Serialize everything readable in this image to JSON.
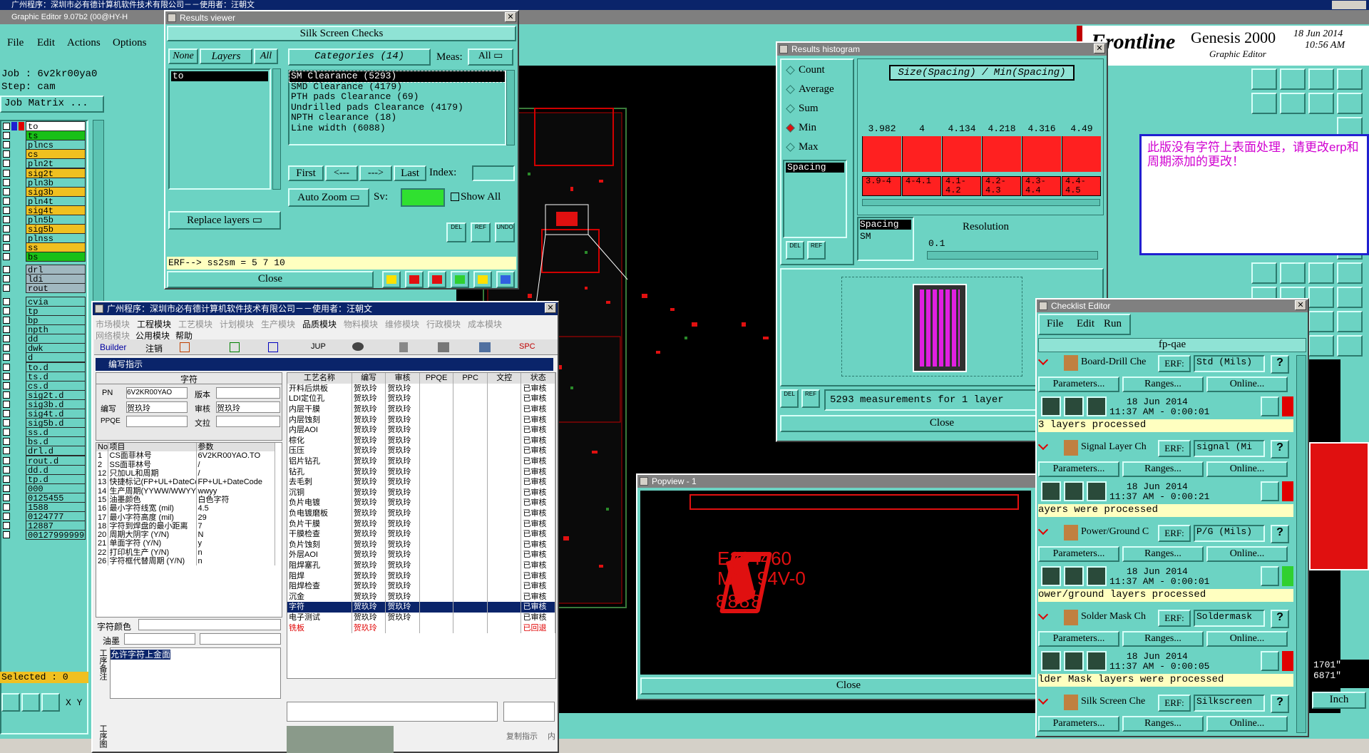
{
  "main_title": "广州程序：深圳市必有德计算机软件技术有限公司－－使用者：汪朝文",
  "ge_title": "Graphic Editor 9.07b2 (00@HY-H",
  "menu": [
    "File",
    "Edit",
    "Actions",
    "Options"
  ],
  "job": "Job : 6v2kr00ya0",
  "step": "Step: cam",
  "job_matrix": "Job Matrix ...",
  "layers": [
    "to",
    "ts",
    "plncs",
    "cs",
    "pln2t",
    "sig2t",
    "pln3b",
    "sig3b",
    "pln4t",
    "sig4t",
    "pln5b",
    "sig5b",
    "plnss",
    "ss",
    "bs",
    "drl",
    "ldi",
    "rout",
    "cvia",
    "tp",
    "bp",
    "npth",
    "dd",
    "dwk",
    "d",
    "to.d",
    "ts.d",
    "cs.d",
    "sig2t.d",
    "sig3b.d",
    "sig4t.d",
    "sig5b.d",
    "ss.d",
    "bs.d",
    "drl.d",
    "rout.d",
    "dd.d",
    "tp.d",
    "000",
    "0125455",
    "1588",
    "0124777",
    "12887",
    "00127999999"
  ],
  "selected": "Selected : 0",
  "xy": "X Y",
  "brand": {
    "name": "Frontline",
    "product": "Genesis 2000",
    "sub": "Graphic Editor",
    "date": "18 Jun 2014",
    "time": "10:56 AM"
  },
  "results": {
    "title": "Results viewer",
    "header": "Silk Screen Checks",
    "none": "None",
    "layers_label": "Layers",
    "all": "All",
    "layer_item": "to",
    "categories": "Categories (14)",
    "meas": "Meas:",
    "meas_val": "All",
    "items": [
      "SM Clearance (5293)",
      "SMD Clearance (4179)",
      "PTH pads Clearance (69)",
      "Undrilled pads Clearance (4179)",
      "NPTH clearance (18)",
      "Line width (6088)"
    ],
    "first": "First",
    "prev": "<---",
    "next": "--->",
    "last": "Last",
    "index": "Index:",
    "auto_zoom": "Auto Zoom",
    "sv": "Sv:",
    "show_all": "Show All",
    "replace": "Replace layers",
    "del": "DEL",
    "ref": "REF",
    "undo": "UNDO",
    "erf": "ERF--> ss2sm = 5 7 10",
    "close": "Close"
  },
  "histogram": {
    "title": "Results histogram",
    "options": [
      "Count",
      "Average",
      "Sum",
      "Min",
      "Max"
    ],
    "selected": "Min",
    "graph_title": "Size(Spacing) / Min(Spacing)",
    "values": [
      "3.982",
      "4",
      "4.134",
      "4.218",
      "4.316",
      "4.49"
    ],
    "bins": [
      "3.9-4",
      "4-4.1",
      "4.1-4.2",
      "4.2-4.3",
      "4.3-4.4",
      "4.4-4.5"
    ],
    "list_item": "Spacing",
    "spacing": "Spacing",
    "sm": "SM",
    "resolution": "Resolution",
    "res_val": "0.1",
    "measurements": "5293 measurements for 1 layer",
    "close": "Close",
    "del": "DEL",
    "ref": "REF",
    "bar_color": "#ff2020"
  },
  "note": "此版没有字符上表面处理，请更改erp和周期添加的更改！",
  "cn": {
    "title": "广州程序：深圳市必有德计算机软件技术有限公司－－使用者：汪朝文",
    "modules": [
      "市场模块",
      "工程模块",
      "工艺模块",
      "计划模块",
      "生产模块",
      "品质模块",
      "物料模块",
      "维修模块",
      "行政模块",
      "成本模块"
    ],
    "modules2": [
      "网络模块",
      "公用模块",
      "帮助"
    ],
    "toolbar": [
      "Builder",
      "注销",
      "JUP",
      "SPC"
    ],
    "section": "编写指示",
    "form_header": "字符",
    "pn_label": "PN",
    "pn": "6V2KR00YAO",
    "ver_label": "版本",
    "writer_label": "编写",
    "writer": "贺玖玲",
    "auditor_label": "审核",
    "auditor": "贺玖玲",
    "ppqe": "PPQE",
    "wl": "文拉",
    "grid_head": [
      "No",
      "项目",
      "参数"
    ],
    "grid": [
      [
        "1",
        "CS面菲林号",
        "6V2KR00YAO.TO"
      ],
      [
        "2",
        "SS面菲林号",
        "/"
      ],
      [
        "12",
        "只加UL和周期",
        "/"
      ],
      [
        "13",
        "快捷标记(FP+UL+DateCo",
        "FP+UL+DateCode"
      ],
      [
        "14",
        "生产周期(YYWW/WWYY)",
        "wwyy"
      ],
      [
        "15",
        "油墨颜色",
        "白色字符"
      ],
      [
        "16",
        "最小字符线宽 (mil)",
        "4.5"
      ],
      [
        "17",
        "最小字符高度 (mil)",
        "29"
      ],
      [
        "18",
        "字符到焊盘的最小距离",
        "7"
      ],
      [
        "20",
        "周期大阴字 (Y/N)",
        "N"
      ],
      [
        "21",
        "单面字符 (Y/N)",
        "y"
      ],
      [
        "22",
        "打印机生产 (Y/N)",
        "n"
      ],
      [
        "26",
        "字符框代替周期 (Y/N)",
        "n"
      ]
    ],
    "char_color": "字符颜色",
    "ink": "油墨",
    "remark_label": "工序备注",
    "remark": "允许字符上金面",
    "process_label": "工序图",
    "table_head": [
      "工艺名称",
      "编写",
      "审核",
      "PPQE",
      "PPC",
      "文控",
      "状态"
    ],
    "table": [
      [
        "开料后烘板",
        "贺玖玲",
        "贺玖玲",
        "已审核"
      ],
      [
        "LDI定位孔",
        "贺玖玲",
        "贺玖玲",
        "已审核"
      ],
      [
        "内层干膜",
        "贺玖玲",
        "贺玖玲",
        "已审核"
      ],
      [
        "内层蚀刻",
        "贺玖玲",
        "贺玖玲",
        "已审核"
      ],
      [
        "内层AOI",
        "贺玖玲",
        "贺玖玲",
        "已审核"
      ],
      [
        "棕化",
        "贺玖玲",
        "贺玖玲",
        "已审核"
      ],
      [
        "压压",
        "贺玖玲",
        "贺玖玲",
        "已审核"
      ],
      [
        "铝片钻孔",
        "贺玖玲",
        "贺玖玲",
        "已审核"
      ],
      [
        "钻孔",
        "贺玖玲",
        "贺玖玲",
        "已审核"
      ],
      [
        "去毛刺",
        "贺玖玲",
        "贺玖玲",
        "已审核"
      ],
      [
        "沉铜",
        "贺玖玲",
        "贺玖玲",
        "已审核"
      ],
      [
        "负片电镀",
        "贺玖玲",
        "贺玖玲",
        "已审核"
      ],
      [
        "负电镀磨板",
        "贺玖玲",
        "贺玖玲",
        "已审核"
      ],
      [
        "负片干膜",
        "贺玖玲",
        "贺玖玲",
        "已审核"
      ],
      [
        "干膜检查",
        "贺玖玲",
        "贺玖玲",
        "已审核"
      ],
      [
        "负片蚀刻",
        "贺玖玲",
        "贺玖玲",
        "已审核"
      ],
      [
        "外层AOI",
        "贺玖玲",
        "贺玖玲",
        "已审核"
      ],
      [
        "阻焊塞孔",
        "贺玖玲",
        "贺玖玲",
        "已审核"
      ],
      [
        "阻焊",
        "贺玖玲",
        "贺玖玲",
        "已审核"
      ],
      [
        "阻焊检查",
        "贺玖玲",
        "贺玖玲",
        "已审核"
      ],
      [
        "沉金",
        "贺玖玲",
        "贺玖玲",
        "已审核"
      ],
      [
        "字符",
        "贺玖玲",
        "贺玖玲",
        "已审核"
      ],
      [
        "电子测试",
        "贺玖玲",
        "贺玖玲",
        "已审核"
      ],
      [
        "铣板",
        "贺玖玲",
        "",
        "已回退"
      ]
    ],
    "copy": "复制指示",
    "inner": "内"
  },
  "popview": {
    "title": "Popview - 1",
    "line1": "E204460",
    "line2": "M11 94V-0",
    "line3": "8888",
    "close": "Close"
  },
  "checklist": {
    "title": "Checklist Editor",
    "menu": [
      "File",
      "Edit",
      "Run"
    ],
    "name": "fp-qae",
    "items": [
      {
        "name": "Board-Drill Che",
        "erf": "Std (Mils)",
        "date": "18 Jun 2014",
        "time": "11:37 AM - 0:00:01",
        "status": "3 layers processed",
        "flag": "#e00000"
      },
      {
        "name": "Signal Layer Ch",
        "erf": "signal (Mi",
        "date": "18 Jun 2014",
        "time": "11:37 AM - 0:00:21",
        "status": "ayers were processed",
        "flag": "#e00000"
      },
      {
        "name": "Power/Ground C",
        "erf": "P/G (Mils)",
        "date": "18 Jun 2014",
        "time": "11:37 AM - 0:00:01",
        "status": "ower/ground layers processed",
        "flag": "#30d030"
      },
      {
        "name": "Solder Mask Ch",
        "erf": "Soldermask",
        "date": "18 Jun 2014",
        "time": "11:37 AM - 0:00:05",
        "status": "lder Mask layers were processed",
        "flag": "#e00000"
      },
      {
        "name": "Silk Screen Che",
        "erf": "Silkscreen"
      }
    ],
    "erf": "ERF:",
    "params": "Parameters...",
    "ranges": "Ranges...",
    "online": "Online..."
  },
  "right": {
    "coords1": "1701\"",
    "coords2": "6871\"",
    "units": "Inch"
  }
}
